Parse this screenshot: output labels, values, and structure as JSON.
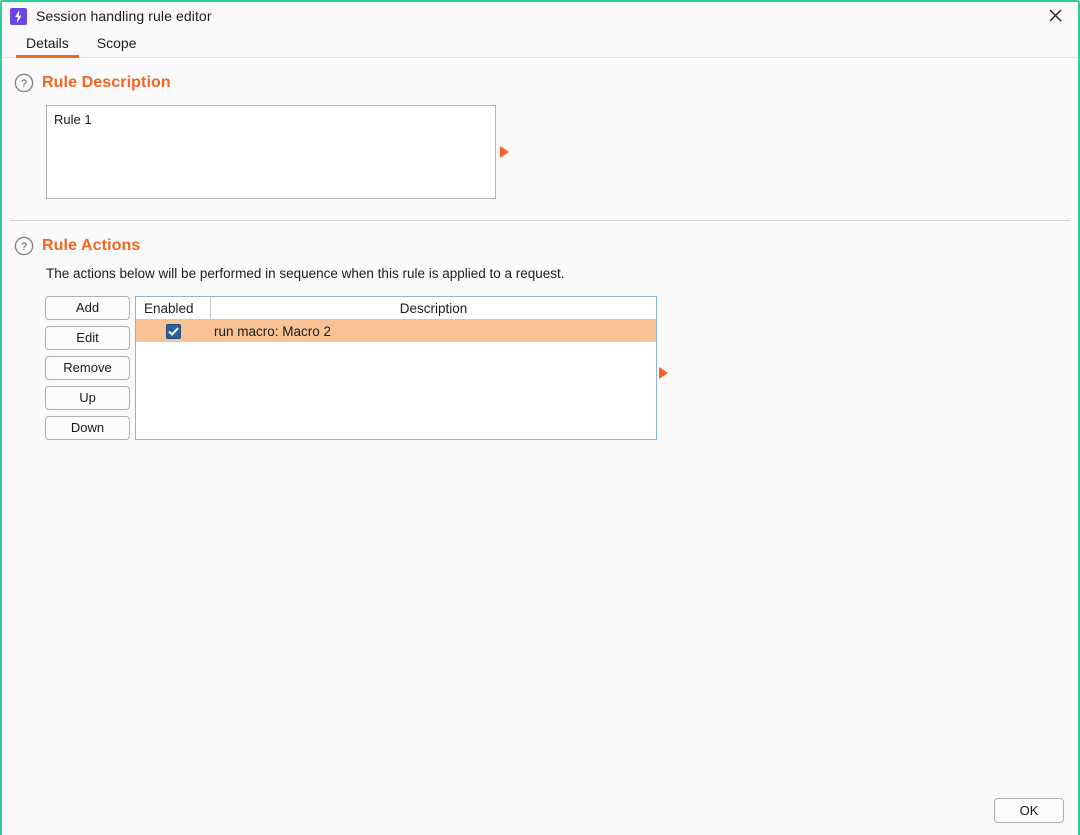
{
  "window": {
    "title": "Session handling rule editor",
    "app_icon": "lightning-bolt-icon",
    "close_icon": "close-icon",
    "accent_border": "#2ecf93",
    "accent_orange": "#f26522",
    "highlight_row": "#f8c295",
    "checkbox_blue": "#2a6099"
  },
  "tabs": [
    {
      "label": "Details",
      "active": true
    },
    {
      "label": "Scope",
      "active": false
    }
  ],
  "rule_description": {
    "heading": "Rule Description",
    "help_icon": "question-circle-icon",
    "value": "Rule 1",
    "placeholder": "",
    "marker_icon": "right-triangle-marker-icon"
  },
  "rule_actions": {
    "heading": "Rule Actions",
    "help_icon": "question-circle-icon",
    "subtitle": "The actions below will be performed in sequence when this rule is applied to a request.",
    "buttons": [
      {
        "label": "Add"
      },
      {
        "label": "Edit"
      },
      {
        "label": "Remove"
      },
      {
        "label": "Up"
      },
      {
        "label": "Down"
      }
    ],
    "table": {
      "columns": [
        "Enabled",
        "Description"
      ],
      "rows": [
        {
          "enabled": true,
          "description": "run macro: Macro 2",
          "selected": true
        }
      ]
    },
    "marker_icon": "right-triangle-marker-icon"
  },
  "footer": {
    "ok_label": "OK"
  }
}
